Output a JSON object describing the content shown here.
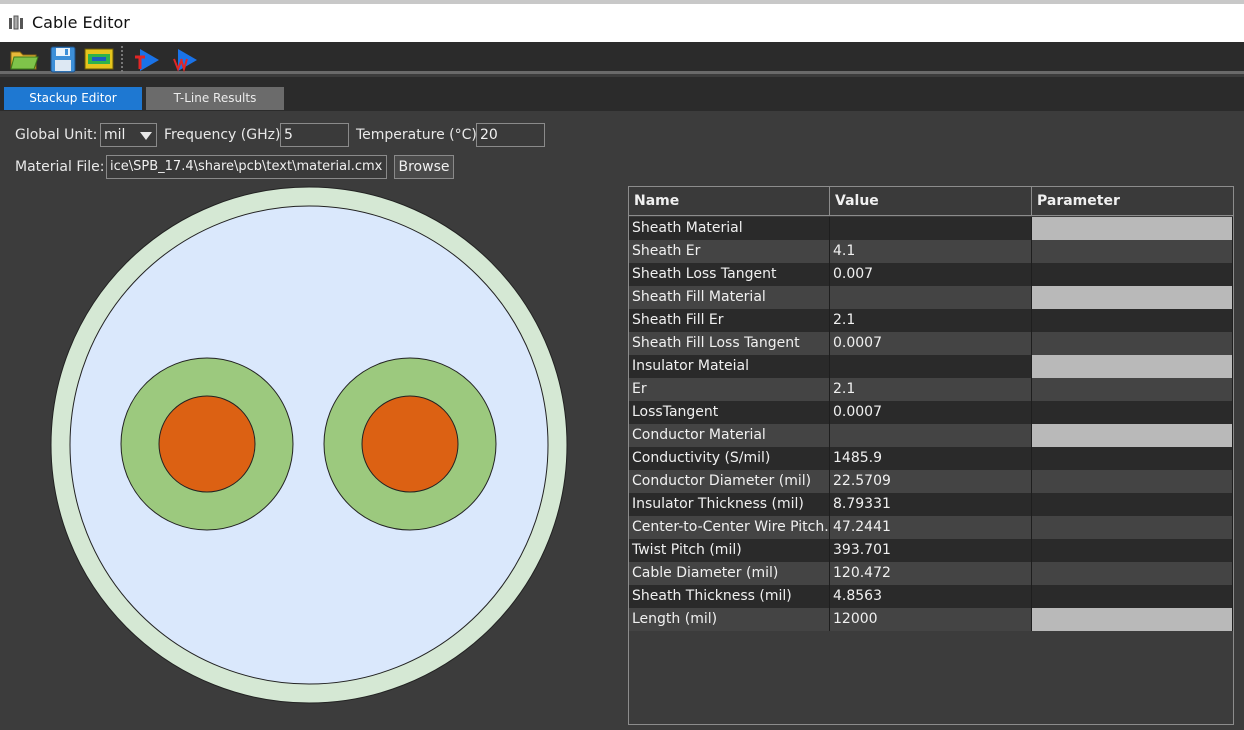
{
  "window": {
    "title": "Cable Editor"
  },
  "toolbar": {
    "buttons": [
      {
        "name": "open-folder-icon"
      },
      {
        "name": "save-icon"
      },
      {
        "name": "stackup-icon"
      },
      {
        "name": "run-icon"
      },
      {
        "name": "run-all-icon"
      }
    ]
  },
  "tabs": [
    {
      "label": "Stackup Editor",
      "active": true
    },
    {
      "label": "T-Line Results",
      "active": false
    }
  ],
  "form": {
    "global_unit_label": "Global Unit:",
    "global_unit_value": "mil",
    "frequency_label": "Frequency (GHz)",
    "frequency_value": "5",
    "temperature_label": "Temperature (°C)",
    "temperature_value": "20",
    "material_file_label": "Material File:",
    "material_file_value": "ice\\SPB_17.4\\share\\pcb\\text\\material.cmx",
    "browse_label": "Browse"
  },
  "colors": {
    "sheath": "#d5e8d4",
    "sheath_fill": "#dae8fc",
    "insulator": "#9cc97e",
    "conductor": "#dc6113",
    "accent_tab": "#1e78d2",
    "parameter_box": "#b9b9b9"
  },
  "grid": {
    "headers": [
      "Name",
      "Value",
      "Parameter"
    ],
    "rows": [
      {
        "name": "Sheath Material",
        "value": "",
        "param_box": true
      },
      {
        "name": "Sheath Er",
        "value": "4.1",
        "param_box": false
      },
      {
        "name": "Sheath Loss Tangent",
        "value": "0.007",
        "param_box": false
      },
      {
        "name": "Sheath Fill Material",
        "value": "",
        "param_box": true
      },
      {
        "name": "Sheath Fill Er",
        "value": "2.1",
        "param_box": false
      },
      {
        "name": "Sheath Fill Loss Tangent",
        "value": "0.0007",
        "param_box": false
      },
      {
        "name": "Insulator Mateial",
        "value": "",
        "param_box": true
      },
      {
        "name": "Er",
        "value": "2.1",
        "param_box": false
      },
      {
        "name": "LossTangent",
        "value": "0.0007",
        "param_box": false
      },
      {
        "name": "Conductor Material",
        "value": "",
        "param_box": true
      },
      {
        "name": "Conductivity (S/mil)",
        "value": "1485.9",
        "param_box": false
      },
      {
        "name": "Conductor Diameter (mil)",
        "value": "22.5709",
        "param_box": false
      },
      {
        "name": "Insulator Thickness (mil)",
        "value": "8.79331",
        "param_box": false
      },
      {
        "name": "Center-to-Center Wire Pitch...",
        "value": "47.2441",
        "param_box": false
      },
      {
        "name": "Twist Pitch (mil)",
        "value": "393.701",
        "param_box": false
      },
      {
        "name": "Cable Diameter (mil)",
        "value": "120.472",
        "param_box": false
      },
      {
        "name": "Sheath Thickness (mil)",
        "value": "4.8563",
        "param_box": false
      },
      {
        "name": "Length (mil)",
        "value": "12000",
        "param_box": true
      }
    ]
  }
}
